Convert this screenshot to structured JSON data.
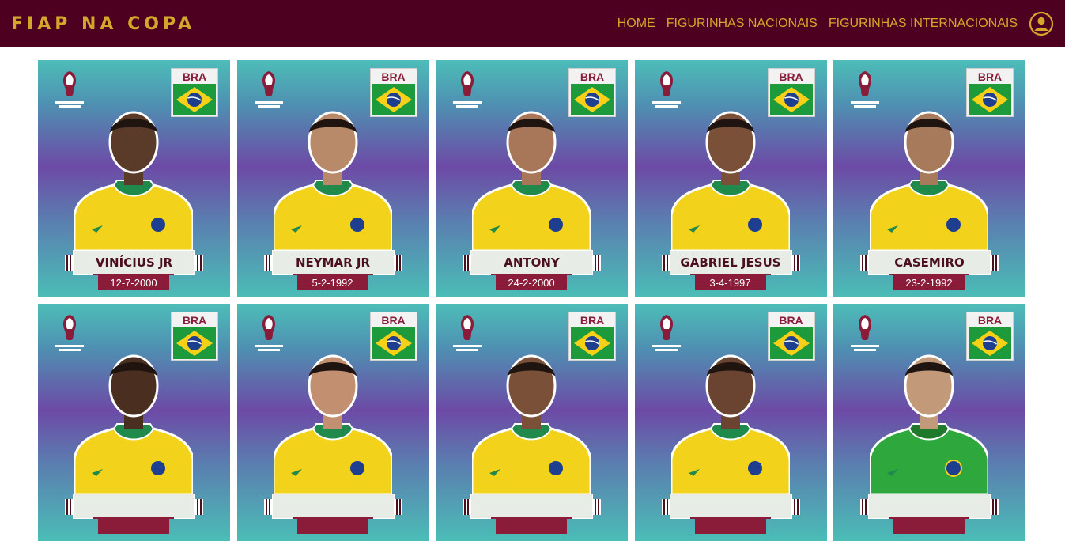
{
  "app": {
    "title": "FIAP NA COPA"
  },
  "nav": {
    "items": [
      {
        "label": "HOME"
      },
      {
        "label": "FIGURINHAS NACIONAIS"
      },
      {
        "label": "FIGURINHAS INTERNACIONAIS"
      }
    ],
    "profile_icon": "user-circle-icon"
  },
  "colors": {
    "header_bg": "#4e0020",
    "header_text": "#d4a72c",
    "accent": "#8a1c3a"
  },
  "cards": [
    {
      "country": "BRA",
      "name": "VINÍCIUS JR",
      "date": "12-7-2000",
      "kit": "yellow",
      "skin": "#5a3a28"
    },
    {
      "country": "BRA",
      "name": "NEYMAR JR",
      "date": "5-2-1992",
      "kit": "yellow",
      "skin": "#b98a6a"
    },
    {
      "country": "BRA",
      "name": "ANTONY",
      "date": "24-2-2000",
      "kit": "yellow",
      "skin": "#a8775a"
    },
    {
      "country": "BRA",
      "name": "GABRIEL JESUS",
      "date": "3-4-1997",
      "kit": "yellow",
      "skin": "#7a5038"
    },
    {
      "country": "BRA",
      "name": "CASEMIRO",
      "date": "23-2-1992",
      "kit": "yellow",
      "skin": "#a87a5c"
    },
    {
      "country": "BRA",
      "name": "",
      "date": "",
      "kit": "yellow",
      "skin": "#4a2e20"
    },
    {
      "country": "BRA",
      "name": "",
      "date": "",
      "kit": "yellow",
      "skin": "#c29070"
    },
    {
      "country": "BRA",
      "name": "",
      "date": "",
      "kit": "yellow",
      "skin": "#7a5038"
    },
    {
      "country": "BRA",
      "name": "",
      "date": "",
      "kit": "yellow",
      "skin": "#6a4430"
    },
    {
      "country": "BRA",
      "name": "",
      "date": "",
      "kit": "green",
      "skin": "#c29a7a"
    }
  ]
}
